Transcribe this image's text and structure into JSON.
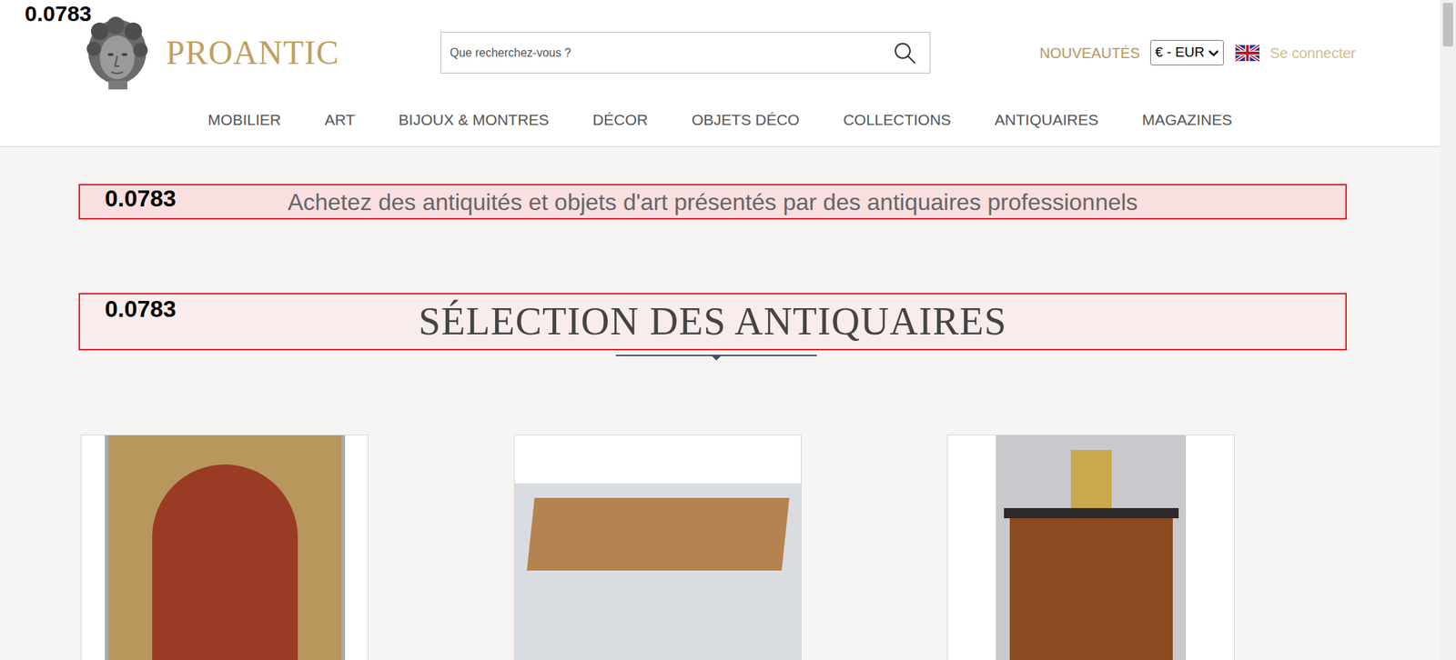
{
  "logo": {
    "score": "0.0783",
    "name": "PROANTIC"
  },
  "search": {
    "placeholder": "Que recherchez-vous ?"
  },
  "header_links": {
    "new": "NOUVEAUTÉS",
    "currency": "€ - EUR",
    "login": "Se connecter"
  },
  "nav": [
    "MOBILIER",
    "ART",
    "BIJOUX & MONTRES",
    "DÉCOR",
    "OBJETS DÉCO",
    "COLLECTIONS",
    "ANTIQUAIRES",
    "MAGAZINES"
  ],
  "tagline": {
    "score": "0.0783",
    "text": "Achetez des antiquités et objets d'art présentés par des antiquaires professionnels"
  },
  "section": {
    "score": "0.0783",
    "title": "SÉLECTION DES ANTIQUAIRES"
  }
}
